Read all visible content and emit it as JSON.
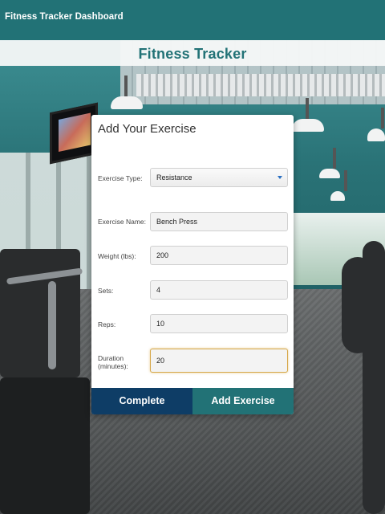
{
  "window": {
    "title": "Fitness Tracker Dashboard"
  },
  "brand": {
    "title": "Fitness Tracker"
  },
  "form": {
    "heading": "Add Your Exercise",
    "fields": {
      "exercise_type": {
        "label": "Exercise Type:",
        "value": "Resistance"
      },
      "exercise_name": {
        "label": "Exercise Name:",
        "value": "Bench Press"
      },
      "weight": {
        "label": "Weight (lbs):",
        "value": "200"
      },
      "sets": {
        "label": "Sets:",
        "value": "4"
      },
      "reps": {
        "label": "Reps:",
        "value": "10"
      },
      "duration": {
        "label": "Duration (minutes):",
        "value": "20"
      }
    },
    "buttons": {
      "complete": "Complete",
      "add": "Add Exercise"
    }
  },
  "colors": {
    "header_bg": "#227276",
    "brand_text": "#227276",
    "complete_button": "#0e3d66",
    "add_button": "#227276",
    "focus_border": "#d6a84a",
    "dropdown_caret": "#2a6fc2"
  },
  "icons": {
    "dropdown": "chevron-down-icon"
  }
}
